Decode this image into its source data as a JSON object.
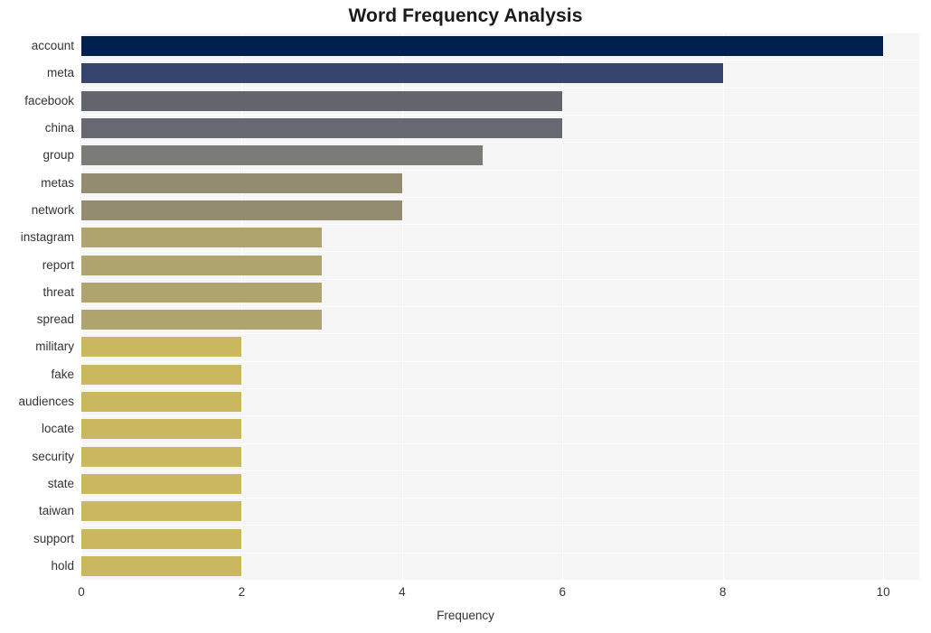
{
  "chart_data": {
    "type": "bar",
    "orientation": "horizontal",
    "title": "Word Frequency Analysis",
    "xlabel": "Frequency",
    "ylabel": "",
    "xlim": [
      0,
      10.45
    ],
    "xticks": [
      0,
      2,
      4,
      6,
      8,
      10
    ],
    "xtick_labels": [
      "0",
      "2",
      "4",
      "6",
      "8",
      "10"
    ],
    "grid": true,
    "grid_axis": "both",
    "legend": false,
    "categories": [
      "account",
      "meta",
      "facebook",
      "china",
      "group",
      "metas",
      "network",
      "instagram",
      "report",
      "threat",
      "spread",
      "military",
      "fake",
      "audiences",
      "locate",
      "security",
      "state",
      "taiwan",
      "support",
      "hold"
    ],
    "values": [
      10,
      8,
      6,
      6,
      5,
      4,
      4,
      3,
      3,
      3,
      3,
      2,
      2,
      2,
      2,
      2,
      2,
      2,
      2,
      2
    ],
    "bar_colors": [
      "#01204e",
      "#36456e",
      "#63656c",
      "#666872",
      "#7b7b78",
      "#948c70",
      "#948c70",
      "#b0a46e",
      "#b0a46e",
      "#b0a46e",
      "#b0a46e",
      "#c9b860",
      "#c9b860",
      "#c9b860",
      "#c9b860",
      "#c9b860",
      "#c9b860",
      "#c9b860",
      "#c9b860",
      "#c9b860"
    ],
    "plot_background": "#f5f5f5",
    "grid_color": "#ffffff",
    "text_color": "#333333",
    "title_color": "#1a1a1a"
  }
}
